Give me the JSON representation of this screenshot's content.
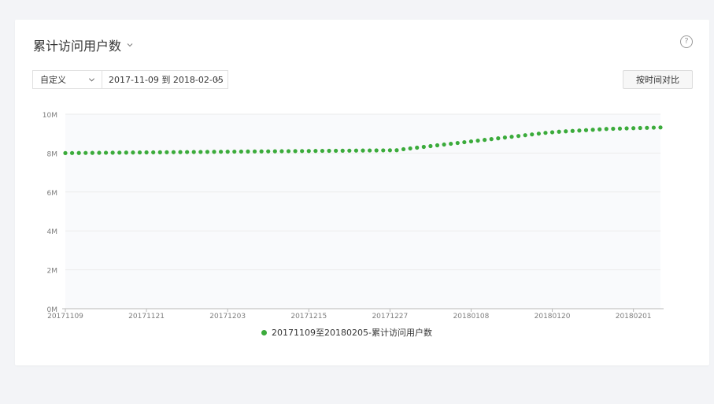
{
  "header": {
    "title": "累计访问用户数",
    "help": "?"
  },
  "filters": {
    "preset": "自定义",
    "range": "2017-11-09 到 2018-02-05",
    "compare_button": "按时间对比"
  },
  "colors": {
    "series": "#3bab3b",
    "plot_bg": "#f9fafc",
    "grid": "#ececec"
  },
  "icons": {
    "title_dropdown": "chevron-down-icon",
    "help": "question-circle-icon",
    "select_dropdown": "chevron-down-icon"
  },
  "chart_data": {
    "type": "scatter",
    "ylim": [
      0,
      10
    ],
    "yunit": "M",
    "yticks": [
      "0M",
      "2M",
      "4M",
      "6M",
      "8M",
      "10M"
    ],
    "xticks": [
      "20171109",
      "20171121",
      "20171203",
      "20171215",
      "20171227",
      "20180108",
      "20180120",
      "20180201"
    ],
    "x_range": [
      "20171109",
      "20180205"
    ],
    "legend": "20171109至20180205-累计访问用户数",
    "legend_position": "bottom",
    "grid": true,
    "series": [
      {
        "name": "20171109至20180205-累计访问用户数",
        "values": [
          8.0,
          8.003,
          8.006,
          8.009,
          8.012,
          8.015,
          8.018,
          8.021,
          8.024,
          8.027,
          8.03,
          8.033,
          8.036,
          8.039,
          8.042,
          8.045,
          8.048,
          8.051,
          8.054,
          8.057,
          8.06,
          8.063,
          8.066,
          8.069,
          8.072,
          8.075,
          8.078,
          8.081,
          8.084,
          8.087,
          8.09,
          8.093,
          8.096,
          8.099,
          8.102,
          8.105,
          8.108,
          8.111,
          8.114,
          8.117,
          8.12,
          8.123,
          8.126,
          8.129,
          8.132,
          8.135,
          8.138,
          8.141,
          8.144,
          8.147,
          8.2,
          8.24,
          8.28,
          8.32,
          8.36,
          8.4,
          8.44,
          8.48,
          8.52,
          8.56,
          8.6,
          8.64,
          8.68,
          8.72,
          8.76,
          8.8,
          8.84,
          8.88,
          8.92,
          8.96,
          9.0,
          9.04,
          9.07,
          9.1,
          9.12,
          9.14,
          9.16,
          9.18,
          9.2,
          9.22,
          9.24,
          9.25,
          9.26,
          9.27,
          9.28,
          9.29,
          9.3,
          9.31,
          9.32
        ]
      }
    ]
  }
}
